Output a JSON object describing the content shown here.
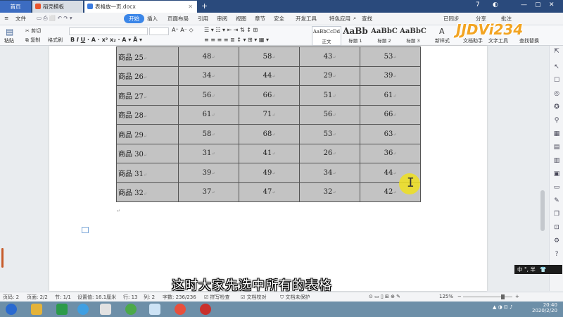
{
  "tabbar": {
    "home": "首页",
    "tab1": "稻壳模板",
    "tab2": "表格放一页.docx",
    "plus": "+",
    "badge": "7"
  },
  "menu": {
    "file": "文件",
    "items": [
      "开始",
      "插入",
      "页面布局",
      "引用",
      "审阅",
      "视图",
      "章节",
      "安全",
      "开发工具",
      "特色应用"
    ],
    "search": "查找",
    "right": [
      "已同步",
      "分享",
      "批注"
    ]
  },
  "ribbon": {
    "paste": "粘贴",
    "cut": "剪切",
    "copy": "复制",
    "format_painter": "格式刷",
    "styles": [
      {
        "preview": "AaBbCcDd",
        "name": "正文"
      },
      {
        "preview": "AaBb",
        "name": "标题 1"
      },
      {
        "preview": "AaBbC",
        "name": "标题 2"
      },
      {
        "preview": "AaBbC",
        "name": "标题 3"
      }
    ],
    "new_style": "新样式",
    "text_assistant": "文档助手",
    "text_tools": "文字工具",
    "find_replace": "查找替换"
  },
  "table": {
    "rows": [
      [
        "商品 25",
        "48",
        "58",
        "43",
        "53"
      ],
      [
        "商品 26",
        "34",
        "44",
        "29",
        "39"
      ],
      [
        "商品 27",
        "56",
        "66",
        "51",
        "61"
      ],
      [
        "商品 28",
        "61",
        "71",
        "56",
        "66"
      ],
      [
        "商品 29",
        "58",
        "68",
        "53",
        "63"
      ],
      [
        "商品 30",
        "31",
        "41",
        "26",
        "36"
      ],
      [
        "商品 31",
        "39",
        "49",
        "34",
        "44"
      ],
      [
        "商品 32",
        "37",
        "47",
        "32",
        "42"
      ]
    ]
  },
  "subtitle": "这时大家先选中所有的表格",
  "ime": "中 °, 半",
  "status": {
    "page_num": "页码: 2",
    "pages": "页面: 2/2",
    "section": "节: 1/1",
    "setting": "设置值: 16.1厘米",
    "row": "行: 13",
    "col": "列: 2",
    "words": "字数: 236/236",
    "spell": "拼写检查",
    "proof": "文档校对",
    "protect": "文档未保护",
    "zoom": "125%"
  },
  "taskbar": {
    "time": "20:40",
    "date": "2020/2/20"
  },
  "watermark": "JJDVi234"
}
